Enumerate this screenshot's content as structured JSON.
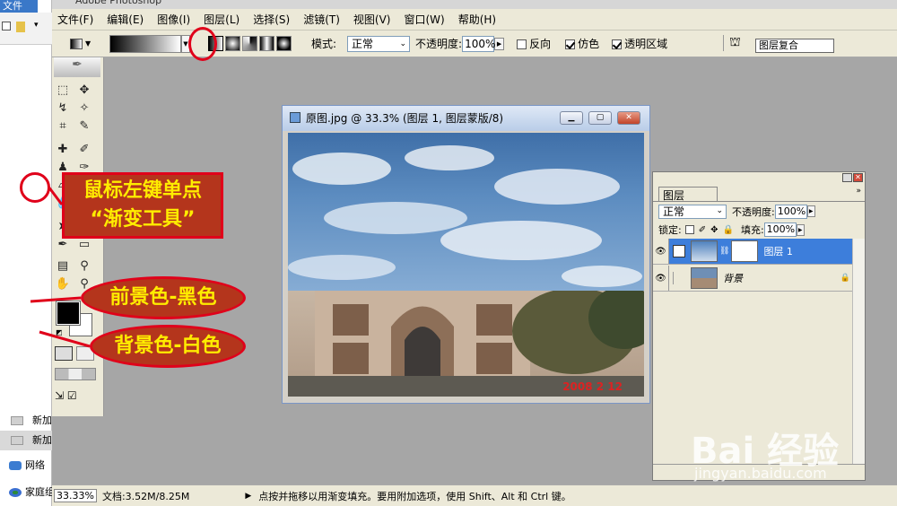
{
  "explorer": {
    "file_tab": "文件",
    "nav": [
      {
        "label": "新加",
        "icon": "drive-icon"
      },
      {
        "label": "新加",
        "icon": "drive-icon"
      },
      {
        "label": "网络",
        "icon": "network-icon"
      },
      {
        "label": "家庭组",
        "icon": "homegroup-icon"
      }
    ]
  },
  "app": {
    "title": "Adobe Photoshop",
    "menu": [
      "文件(F)",
      "编辑(E)",
      "图像(I)",
      "图层(L)",
      "选择(S)",
      "滤镜(T)",
      "视图(V)",
      "窗口(W)",
      "帮助(H)"
    ]
  },
  "options": {
    "mode_label": "模式:",
    "mode_value": "正常",
    "opacity_label": "不透明度:",
    "opacity_value": "100%",
    "reverse_label": "反向",
    "dither_label": "仿色",
    "transparency_label": "透明区域",
    "dither_checked": true,
    "transparency_checked": true,
    "reverse_checked": false,
    "palette_tab": "图层复合"
  },
  "document": {
    "title": "原图.jpg @ 33.3% (图层 1, 图层蒙版/8)",
    "date_stamp": "2008 2 12"
  },
  "layers_panel": {
    "tab": "图层",
    "blend_mode": "正常",
    "opacity_label": "不透明度:",
    "opacity_value": "100%",
    "lock_label": "锁定:",
    "fill_label": "填充:",
    "fill_value": "100%",
    "layers": [
      {
        "name": "图层 1",
        "active": true
      },
      {
        "name": "背景",
        "active": false
      }
    ]
  },
  "status": {
    "zoom": "33.33%",
    "doc_size": "文档:3.52M/8.25M",
    "hint": "点按并拖移以用渐变填充。要用附加选项，使用 Shift、Alt 和 Ctrl 键。"
  },
  "annotations": {
    "gradient_tool": "鼠标左键单点“渐变工具”",
    "gradient_tool_line1": "鼠标左键单点",
    "gradient_tool_line2": "“渐变工具”",
    "foreground": "前景色-黑色",
    "background": "背景色-白色"
  },
  "watermark": {
    "text": "Bai 经验",
    "url": "jingyan.baidu.com"
  },
  "colors": {
    "accent_red": "#e0001a",
    "annotation_fill": "#b4351c",
    "annotation_text": "#ffec00",
    "workspace": "#a6a6a6"
  }
}
